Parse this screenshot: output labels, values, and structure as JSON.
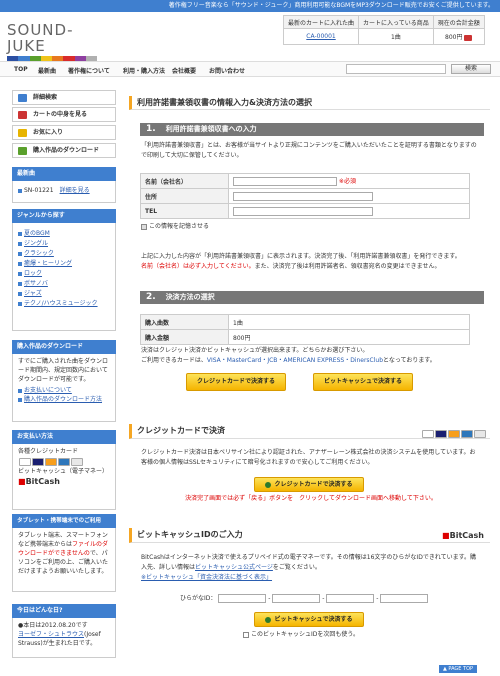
{
  "topbar": {
    "text": "著作権フリー音楽なら「サウンド・ジューク」商用利用可能なBGMをMP3ダウンロード販売でお安くご提供しています。"
  },
  "logo": {
    "text": "SOUND-JUKE",
    "colors": [
      "#2b4fa3",
      "#3f7fcf",
      "#5aa02c",
      "#f0c419",
      "#e8781f",
      "#d92b2b",
      "#8e3fa0",
      "#b0b0b0"
    ]
  },
  "info": {
    "headers": [
      "最新のカートに入れた曲",
      "カートに入っている商品",
      "現在の合計金額"
    ],
    "cart_code": "CA-00001",
    "count": "1曲",
    "total": "800円"
  },
  "nav": {
    "items": [
      "TOP",
      "最新曲",
      "著作権について",
      "利用・購入方法",
      "会社概要",
      "お問い合わせ"
    ],
    "search_button": "検索"
  },
  "sidebar": {
    "buttons": [
      "詳細検索",
      "カートの中身を見る",
      "お気に入り",
      "購入作品のダウンロード"
    ],
    "latest": {
      "title": "最新曲",
      "code": "SN-01221",
      "link": "詳細を見る"
    },
    "genre": {
      "title": "ジャンルから探す",
      "items": [
        "夏のBGM",
        "ジングル",
        "クラシック",
        "癒爆・ヒーリング",
        "ロック",
        "ボサノバ",
        "ジャズ",
        "テクノ/ハウスミュージック"
      ]
    },
    "download": {
      "title": "購入作品のダウンロード",
      "text": "すでにご購入された曲をダウンロード期間内、規定回数内においてダウンロードが可能です。",
      "links": [
        "お支払いについて",
        "購入作品のダウンロード方法"
      ]
    },
    "payment": {
      "title": "お支払い方法",
      "line1": "各種クレジットカード",
      "line2": "ビットキャッシュ（電子マネー）",
      "bitcash": "BitCash"
    },
    "tablet": {
      "title": "タブレット・携帯端末でのご利用",
      "text_a": "タブレット端末、スマートフォンなど携帯端末からは",
      "text_red": "ファイルのダウンロードができませんの",
      "text_b": "で、パソコンをご利用の上、ご購入いただけますようお願いいたします。"
    },
    "today": {
      "title": "今日はどんな日?",
      "text": "●本日は2012.08.20です",
      "link": "ヨーゼフ・シュトラウス",
      "text2": "(Josef Strauss)が生まれた日です。"
    }
  },
  "main": {
    "title": "利用許諾書兼領収書の情報入力&決済方法の選択",
    "s1": {
      "num": "1.",
      "title": "利用許諾書兼領収書への入力",
      "p": "「利用許諾書兼領収書」とは、お客様が当サイトより正規にコンテンツをご購入いただいたことを証明する書類となりますので印刷して大切に保管してください。",
      "fields": [
        {
          "label": "名前（会社名）",
          "required": "※必須"
        },
        {
          "label": "住所"
        },
        {
          "label": "TEL"
        }
      ],
      "remember": "この情報を記憶させる",
      "note_a": "上記に入力した内容が「利用許諾書兼領収書」に表示されます。決済完了後、「利用許諾書兼領収書」を発行できます。",
      "note_red": "名前（会社名）は必ず入力してください。",
      "note_b": "また、決済完了後は利用許諾者名、領収書宛名の変更はできません。"
    },
    "s2": {
      "num": "2.",
      "title": "決済方法の選択",
      "rows": [
        {
          "label": "購入曲数",
          "value": "1曲"
        },
        {
          "label": "購入金額",
          "value": "800円"
        }
      ],
      "p1": "決済はクレジット決済かビットキャッシュが選択出来ます。どちらかお選び下さい。",
      "p2": "ご利用できるカードは、",
      "cards": "VISA・MasterCard・JCB・AMERICAN EXPRESS・DinersClub",
      "p2b": "となっております。",
      "btn_credit": "クレジットカードで決済する",
      "btn_bitcash": "ビットキャッシュで決済する"
    },
    "credit": {
      "title": "クレジットカードで決済",
      "p": "クレジットカード決済は日本ベリサイン社により認証された、アナザーレーン株式会社の決済システムを使用しています。お客様の個人情報はSSLセキュリティにて暗号化されますので安心してご利用ください。",
      "btn": "クレジットカードで決済する",
      "warn": "決済完了画面では必ず「戻る」ボタンを　クリックしてダウンロード画面へ移動して下さい。"
    },
    "bitcash": {
      "title": "ビットキャッシュIDのご入力",
      "logo": "BitCash",
      "p1": "BitCashはインターネット決済で使えるプリペイド式の電子マネーです。その情報は16文字のひらがなIDできれています。購入先、詳しい情報は",
      "link1": "ビットキャッシュ公式ページ",
      "p1b": "をご覧ください。",
      "link2": "※ビットキャッシュ「資金決済法に基づく表示」",
      "id_label": "ひらがなID：",
      "btn": "ビットキャッシュで決済する",
      "remember": "このビットキャッシュIDを次回も使う。"
    }
  },
  "footer": {
    "pagetop": "▲ PAGE TOP"
  }
}
